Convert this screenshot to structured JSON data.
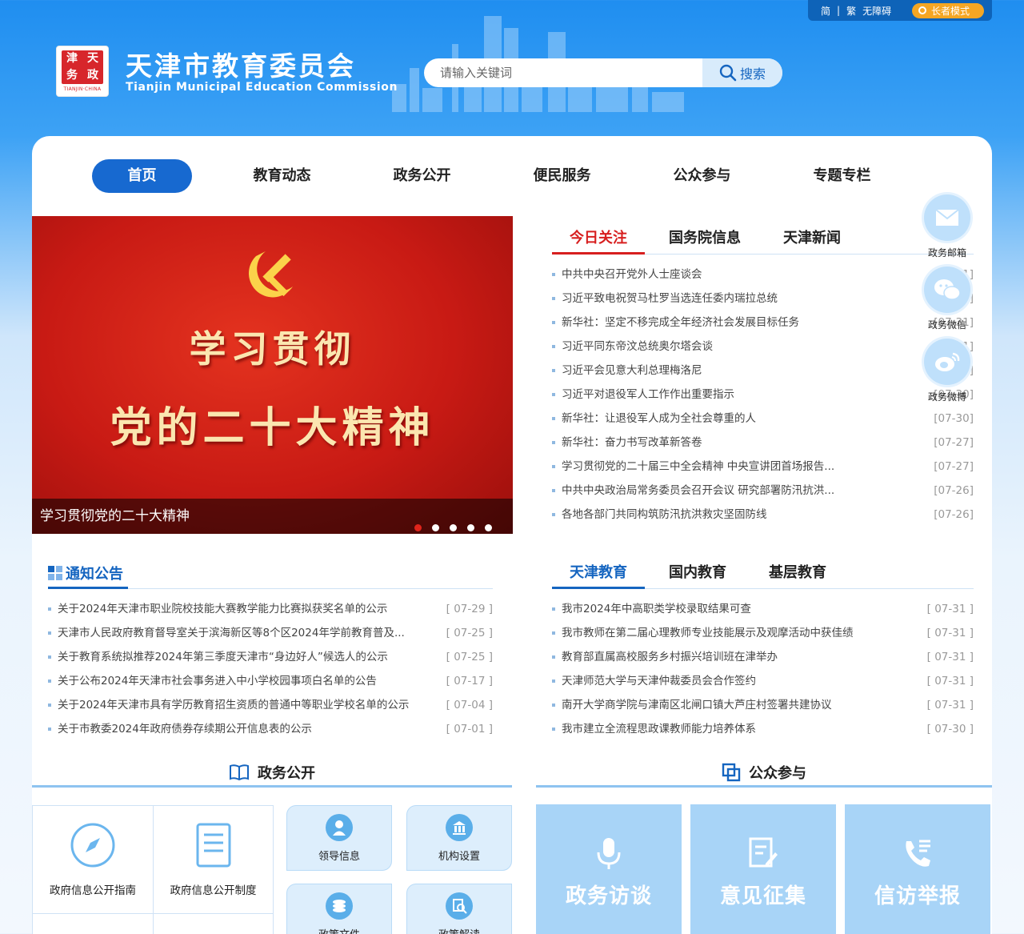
{
  "topbar": {
    "simplified": "简",
    "separator": "|",
    "traditional": "繁",
    "accessibility": "无障碍",
    "elder_mode": "长者模式"
  },
  "header": {
    "title": "天津市教育委员会",
    "subtitle": "Tianjin Municipal Education Commission",
    "seal_chars": [
      "天",
      "津",
      "政",
      "务"
    ],
    "seal_sub": "TIANJIN·CHINA",
    "search_placeholder": "请输入关键词",
    "search_button": "搜索"
  },
  "nav": {
    "items": [
      "首页",
      "教育动态",
      "政务公开",
      "便民服务",
      "公众参与",
      "专题专栏"
    ],
    "active": "首页"
  },
  "slider": {
    "line1": "学习贯彻",
    "line2": "党的二十大精神",
    "caption": "学习贯彻党的二十大精神",
    "slide_count": 5,
    "active_slide": 1
  },
  "news_tabs": {
    "tabs": [
      "今日关注",
      "国务院信息",
      "天津新闻"
    ],
    "items": [
      {
        "title": "中共中央召开党外人士座谈会",
        "date": "[07-31]"
      },
      {
        "title": "习近平致电祝贺马杜罗当选连任委内瑞拉总统",
        "date": "[07-31]"
      },
      {
        "title": "新华社：坚定不移完成全年经济社会发展目标任务",
        "date": "[07-31]"
      },
      {
        "title": "习近平同东帝汶总统奥尔塔会谈",
        "date": "[07-31]"
      },
      {
        "title": "习近平会见意大利总理梅洛尼",
        "date": "[07-30]"
      },
      {
        "title": "习近平对退役军人工作作出重要指示",
        "date": "[07-30]"
      },
      {
        "title": "新华社：让退役军人成为全社会尊重的人",
        "date": "[07-30]"
      },
      {
        "title": "新华社：奋力书写改革新答卷",
        "date": "[07-27]"
      },
      {
        "title": "学习贯彻党的二十届三中全会精神 中央宣讲团首场报告...",
        "date": "[07-27]"
      },
      {
        "title": "中共中央政治局常务委员会召开会议 研究部署防汛抗洪...",
        "date": "[07-26]"
      },
      {
        "title": "各地各部门共同构筑防汛抗洪救灾坚固防线",
        "date": "[07-26]"
      }
    ]
  },
  "notices": {
    "title": "通知公告",
    "items": [
      {
        "title": "关于2024年天津市职业院校技能大赛教学能力比赛拟获奖名单的公示",
        "date": "[ 07-29 ]"
      },
      {
        "title": "天津市人民政府教育督导室关于滨海新区等8个区2024年学前教育普及...",
        "date": "[ 07-25 ]"
      },
      {
        "title": "关于教育系统拟推荐2024年第三季度天津市“身边好人”候选人的公示",
        "date": "[ 07-25 ]"
      },
      {
        "title": "关于公布2024年天津市社会事务进入中小学校园事项白名单的公告",
        "date": "[ 07-17 ]"
      },
      {
        "title": "关于2024年天津市具有学历教育招生资质的普通中等职业学校名单的公示",
        "date": "[ 07-04 ]"
      },
      {
        "title": "关于市教委2024年政府债券存续期公开信息表的公示",
        "date": "[ 07-01 ]"
      }
    ]
  },
  "edu_tabs": {
    "tabs": [
      "天津教育",
      "国内教育",
      "基层教育"
    ],
    "items": [
      {
        "title": "我市2024年中高职类学校录取结果可查",
        "date": "[ 07-31 ]"
      },
      {
        "title": "我市教师在第二届心理教师专业技能展示及观摩活动中获佳绩",
        "date": "[ 07-31 ]"
      },
      {
        "title": "教育部直属高校服务乡村振兴培训班在津举办",
        "date": "[ 07-31 ]"
      },
      {
        "title": "天津师范大学与天津仲裁委员会合作签约",
        "date": "[ 07-31 ]"
      },
      {
        "title": "南开大学商学院与津南区北闸口镇大芦庄村签署共建协议",
        "date": "[ 07-31 ]"
      },
      {
        "title": "我市建立全流程思政课教师能力培养体系",
        "date": "[ 07-30 ]"
      }
    ]
  },
  "float_bar": [
    {
      "label": "政务邮箱",
      "icon": "mail-icon"
    },
    {
      "label": "政务微信",
      "icon": "wechat-icon"
    },
    {
      "label": "政务微博",
      "icon": "weibo-icon"
    }
  ],
  "gov_open": {
    "title": "政务公开",
    "plain_tiles": [
      "政府信息公开指南",
      "政府信息公开制度"
    ],
    "round_tiles": [
      "领导信息",
      "机构设置",
      "政策文件",
      "政策解读"
    ]
  },
  "participation": {
    "title": "公众参与",
    "tiles": [
      "政务访谈",
      "意见征集",
      "信访举报"
    ]
  },
  "colors": {
    "primary": "#1769d0",
    "accent_red": "#d71f1f",
    "tile_blue": "#a8d4f7"
  }
}
